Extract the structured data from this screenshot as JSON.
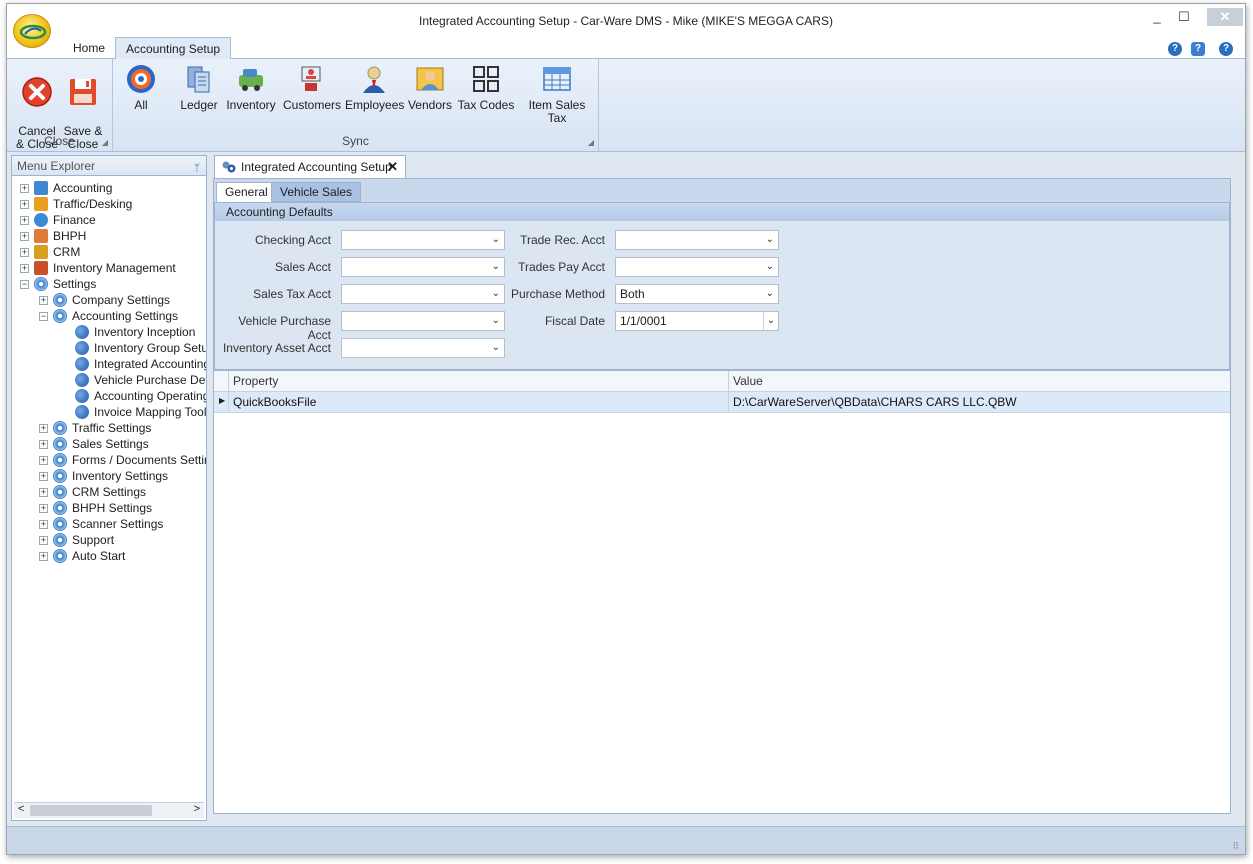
{
  "window": {
    "title": "Integrated Accounting Setup - Car-Ware DMS - Mike (MIKE'S MEGGA CARS)",
    "controls": {
      "minimize": "_",
      "maximize": "☐",
      "close": "✕"
    }
  },
  "ribbon_tabs": [
    {
      "label": "Home"
    },
    {
      "label": "Accounting Setup"
    }
  ],
  "help_icons": [
    "?",
    "?",
    "?"
  ],
  "ribbon": {
    "groups": [
      {
        "label": "Close",
        "buttons": [
          {
            "label": "Cancel\n& Close",
            "icon": "cancel-icon"
          },
          {
            "label": "Save &\nClose",
            "icon": "save-icon"
          }
        ]
      },
      {
        "label": "Sync",
        "buttons": [
          {
            "label": "All",
            "icon": "sync-all-icon"
          },
          {
            "label": "Ledger",
            "icon": "ledger-icon"
          },
          {
            "label": "Inventory",
            "icon": "inventory-icon"
          },
          {
            "label": "Customers",
            "icon": "customers-icon"
          },
          {
            "label": "Employees",
            "icon": "employees-icon"
          },
          {
            "label": "Vendors",
            "icon": "vendors-icon"
          },
          {
            "label": "Tax Codes",
            "icon": "tax-codes-icon"
          },
          {
            "label": "Item Sales Tax",
            "icon": "item-sales-tax-icon"
          }
        ]
      }
    ]
  },
  "menu_explorer": {
    "title": "Menu Explorer",
    "pin": "ᛘ",
    "items": [
      {
        "label": "Accounting",
        "level": 0,
        "expander": "+",
        "icon": "calculator-icon"
      },
      {
        "label": "Traffic/Desking",
        "level": 0,
        "expander": "+",
        "icon": "pin-icon"
      },
      {
        "label": "Finance",
        "level": 0,
        "expander": "+",
        "icon": "dollar-icon"
      },
      {
        "label": "BHPH",
        "level": 0,
        "expander": "+",
        "icon": "handshake-icon"
      },
      {
        "label": "CRM",
        "level": 0,
        "expander": "+",
        "icon": "crm-icon"
      },
      {
        "label": "Inventory Management",
        "level": 0,
        "expander": "+",
        "icon": "car-icon"
      },
      {
        "label": "Settings",
        "level": 0,
        "expander": "−",
        "icon": "gear-icon"
      },
      {
        "label": "Company Settings",
        "level": 1,
        "expander": "+",
        "icon": "gear-icon"
      },
      {
        "label": "Accounting Settings",
        "level": 1,
        "expander": "−",
        "icon": "gear-icon"
      },
      {
        "label": "Inventory Inception",
        "level": 2,
        "expander": "",
        "icon": "gears-icon"
      },
      {
        "label": "Inventory Group Setup",
        "level": 2,
        "expander": "",
        "icon": "gears-icon"
      },
      {
        "label": "Integrated Accounting",
        "level": 2,
        "expander": "",
        "icon": "gears-icon"
      },
      {
        "label": "Vehicle Purchase Defa",
        "level": 2,
        "expander": "",
        "icon": "gears-icon"
      },
      {
        "label": "Accounting Operating",
        "level": 2,
        "expander": "",
        "icon": "gears-icon"
      },
      {
        "label": "Invoice Mapping Tool",
        "level": 2,
        "expander": "",
        "icon": "gears-icon"
      },
      {
        "label": "Traffic Settings",
        "level": 1,
        "expander": "+",
        "icon": "gear-icon"
      },
      {
        "label": "Sales Settings",
        "level": 1,
        "expander": "+",
        "icon": "gear-icon"
      },
      {
        "label": "Forms / Documents Setting",
        "level": 1,
        "expander": "+",
        "icon": "gear-icon"
      },
      {
        "label": "Inventory Settings",
        "level": 1,
        "expander": "+",
        "icon": "gear-icon"
      },
      {
        "label": "CRM Settings",
        "level": 1,
        "expander": "+",
        "icon": "gear-icon"
      },
      {
        "label": "BHPH Settings",
        "level": 1,
        "expander": "+",
        "icon": "gear-icon"
      },
      {
        "label": "Scanner Settings",
        "level": 1,
        "expander": "+",
        "icon": "gear-icon"
      },
      {
        "label": "Support",
        "level": 1,
        "expander": "+",
        "icon": "gear-icon"
      },
      {
        "label": "Auto Start",
        "level": 1,
        "expander": "+",
        "icon": "gear-icon"
      }
    ],
    "scroll_left": "<",
    "scroll_right": ">"
  },
  "document": {
    "tab_label": "Integrated Accounting Setup",
    "tab_close": "✕",
    "subtabs": [
      {
        "label": "General"
      },
      {
        "label": "Vehicle Sales"
      }
    ],
    "group_title": "Accounting Defaults",
    "fields_left": [
      {
        "label": "Checking Acct",
        "value": ""
      },
      {
        "label": "Sales Acct",
        "value": ""
      },
      {
        "label": "Sales Tax Acct",
        "value": ""
      },
      {
        "label": "Vehicle Purchase Acct",
        "value": ""
      },
      {
        "label": "Inventory Asset Acct",
        "value": ""
      }
    ],
    "fields_right": [
      {
        "label": "Trade Rec. Acct",
        "value": ""
      },
      {
        "label": "Trades Pay Acct",
        "value": ""
      },
      {
        "label": "Purchase Method",
        "value": "Both"
      },
      {
        "label": "Fiscal Date",
        "value": "1/1/0001"
      }
    ],
    "dropdown_arrow": "⌄",
    "grid": {
      "columns": [
        "Property",
        "Value"
      ],
      "rows": [
        {
          "property": "QuickBooksFile",
          "value": "D:\\CarWareServer\\QBData\\CHARS CARS LLC.QBW"
        }
      ],
      "row_indicator": "▶"
    }
  },
  "status": {
    "grip": "⠿"
  }
}
